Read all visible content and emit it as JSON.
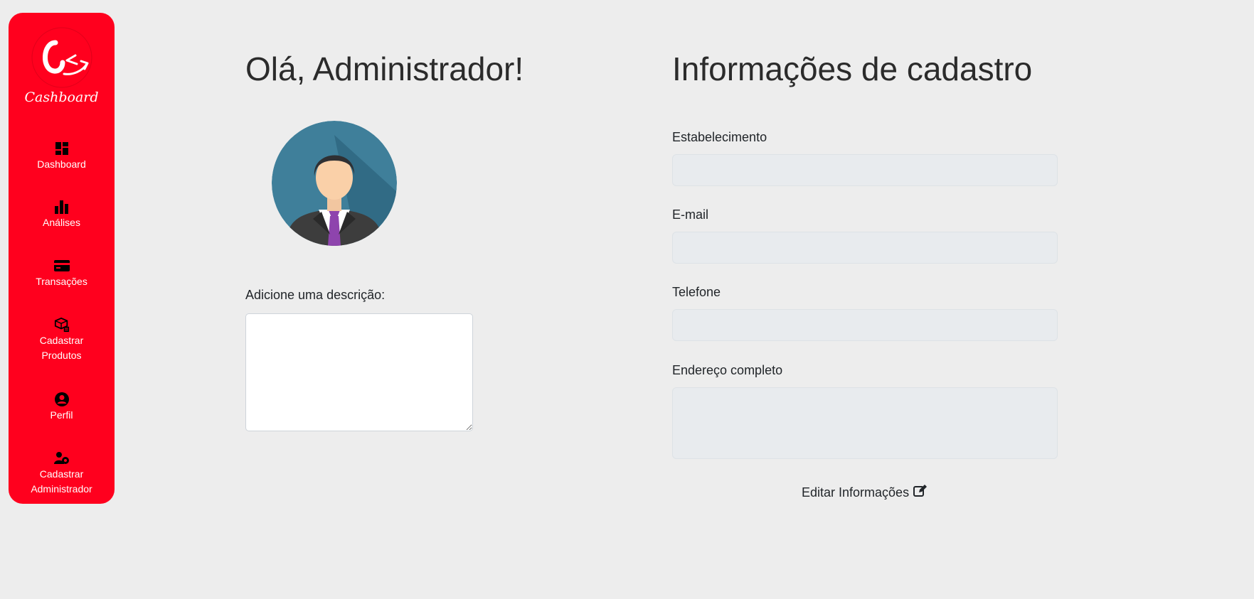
{
  "brand": {
    "name": "Cashboard",
    "accent": "#ff001e"
  },
  "sidebar": {
    "items": [
      {
        "label": "Dashboard",
        "icon": "dashboard-icon"
      },
      {
        "label": "Análises",
        "icon": "bar-chart-icon"
      },
      {
        "label": "Transações",
        "icon": "credit-card-icon"
      },
      {
        "label_lines": [
          "Cadastrar",
          "Produtos"
        ],
        "icon": "package-icon"
      },
      {
        "label": "Perfil",
        "icon": "user-circle-icon"
      },
      {
        "label_lines": [
          "Cadastrar",
          "Administrador"
        ],
        "icon": "user-gear-icon"
      }
    ]
  },
  "profile": {
    "greeting": "Olá, Administrador!",
    "description_label": "Adicione uma descrição:",
    "description_value": ""
  },
  "registration": {
    "title": "Informações de cadastro",
    "fields": [
      {
        "label": "Estabelecimento",
        "value": ""
      },
      {
        "label": "E-mail",
        "value": ""
      },
      {
        "label": "Telefone",
        "value": ""
      },
      {
        "label": "Endereço completo",
        "value": ""
      }
    ],
    "edit_label": "Editar Informações",
    "edit_icon": "edit-icon"
  }
}
